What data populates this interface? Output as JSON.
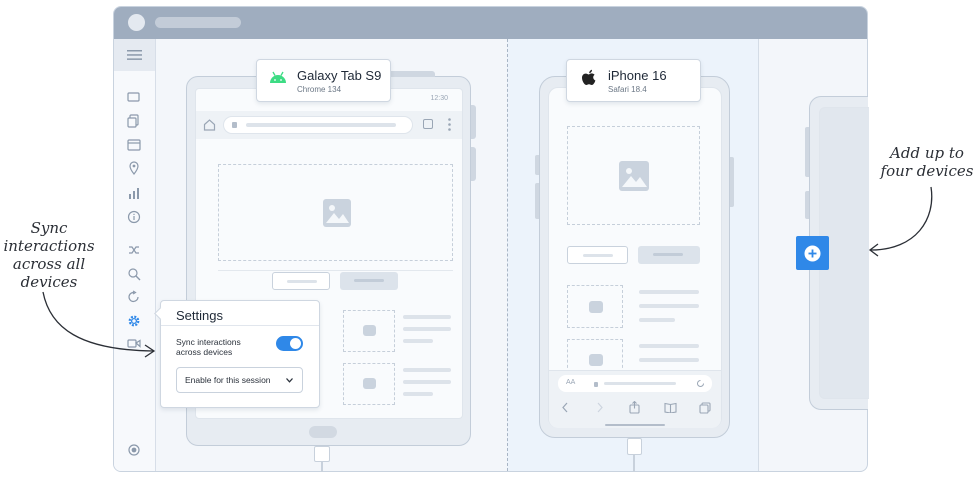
{
  "callouts": {
    "left_lines": [
      "Sync",
      "interactions",
      "across all",
      "devices"
    ],
    "right_lines": [
      "Add up to",
      "four devices"
    ]
  },
  "devices": [
    {
      "name": "Galaxy Tab S9",
      "browser": "Chrome 134",
      "icon": "android-icon",
      "status_time": "12:30"
    },
    {
      "name": "iPhone 16",
      "browser": "Safari 18.4",
      "icon": "apple-icon"
    }
  ],
  "settings": {
    "title": "Settings",
    "sync_label_lines": [
      "Sync interactions",
      "across devices"
    ],
    "sync_enabled": true,
    "select_value": "Enable for this session"
  },
  "safari_bar": {
    "text_size_label": "AA"
  },
  "colors": {
    "accent": "#2f88e8",
    "titlebar": "#9fadbf"
  }
}
